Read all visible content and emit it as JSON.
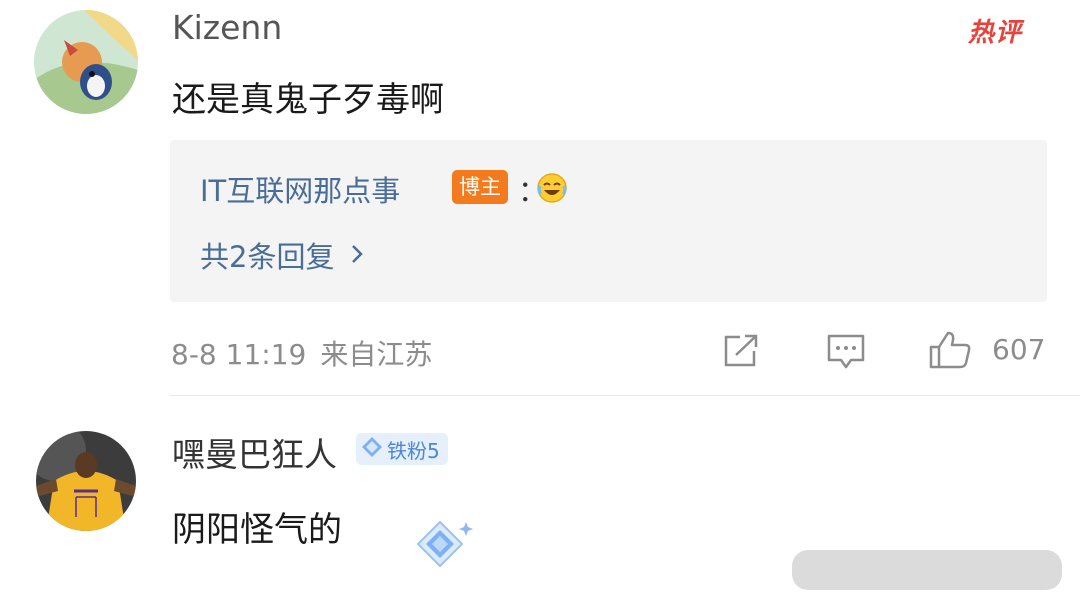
{
  "comments": [
    {
      "username": "Kizenn",
      "hot_label": "热评",
      "text": "还是真鬼子歹毒啊",
      "reply": {
        "author": "IT互联网那点事",
        "author_badge": "博主",
        "separator": "：",
        "emoji_icon": "laughing-crying-emoji",
        "more_replies_label": "共2条回复",
        "more_replies_icon": "chevron-right-icon"
      },
      "date": "8-8 11:19",
      "location": "来自江苏",
      "actions": {
        "share_icon": "share-icon",
        "comment_icon": "comment-icon",
        "like_icon": "thumbs-up-icon",
        "like_count": "607"
      }
    },
    {
      "username": "嘿曼巴狂人",
      "fan_badge": "铁粉5",
      "text": "阴阳怪气的",
      "sticker_icon": "diamond-sticker-icon"
    }
  ],
  "colors": {
    "link_blue": "#4a6d98",
    "hot_red": "#e8423a",
    "badge_orange": "#f37b1d",
    "fan_badge_blue": "#4d86d6",
    "meta_gray": "#8c8c8c"
  }
}
